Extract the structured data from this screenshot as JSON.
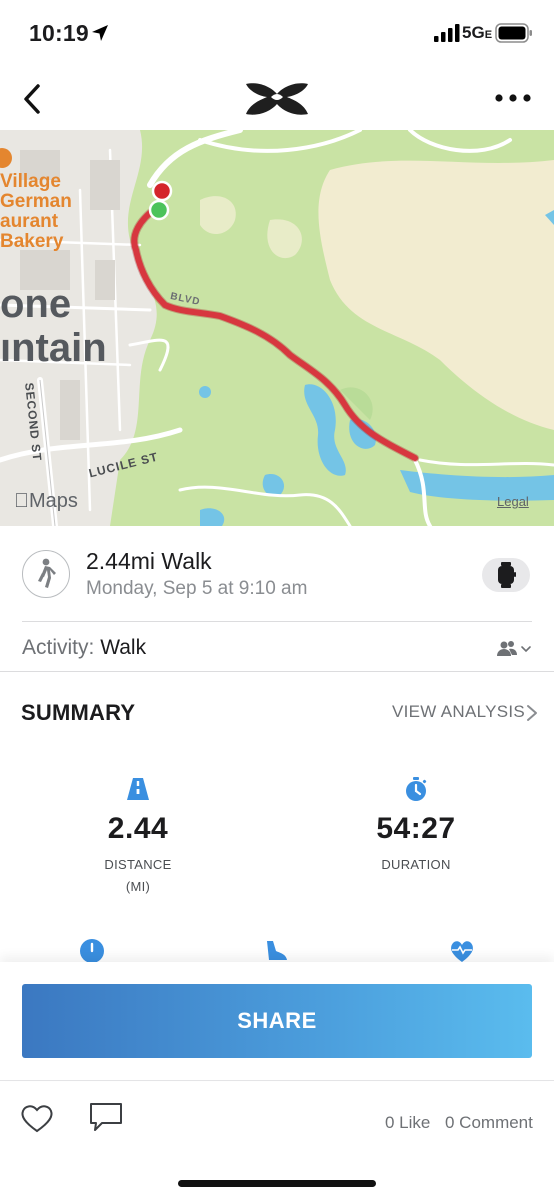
{
  "status_bar": {
    "time": "10:19",
    "network": "5G",
    "network_suffix": "E"
  },
  "nav": {
    "back_icon": "chevron-left-icon",
    "brand": "Under Armour",
    "more_icon": "more-horizontal-icon"
  },
  "map": {
    "poi_lines": [
      "Village",
      "German",
      "aurant",
      "Bakery"
    ],
    "town_lines": [
      "one",
      "ıntain"
    ],
    "streets": {
      "second_st": "SECOND ST",
      "lucile_st": "LUCILE ST",
      "route_road": "BLVD"
    },
    "brand": "Maps",
    "legal": "Legal",
    "route_color": "#d7373f",
    "start_color": "#4cc35a",
    "end_color": "#d4252b"
  },
  "workout": {
    "title": "2.44mi Walk",
    "date": "Monday, Sep 5 at 9:10 am",
    "type_icon": "walking-person-icon",
    "device_icon": "watch-icon"
  },
  "activity": {
    "label": "Activity:",
    "value": "Walk",
    "privacy_icon": "friends-icon"
  },
  "summary": {
    "heading": "SUMMARY",
    "view_analysis": "VIEW ANALYSIS",
    "stats": [
      {
        "icon": "road-icon",
        "value": "2.44",
        "caption": "DISTANCE",
        "unit": "(MI)"
      },
      {
        "icon": "stopwatch-icon",
        "value": "54:27",
        "caption": "DURATION",
        "unit": ""
      }
    ]
  },
  "share": {
    "label": "SHARE"
  },
  "social": {
    "likes": "0 Like",
    "comments": "0 Comment"
  },
  "colors": {
    "accent": "#3a8fe0",
    "share_start": "#3b78c1",
    "share_end": "#5abcee"
  }
}
